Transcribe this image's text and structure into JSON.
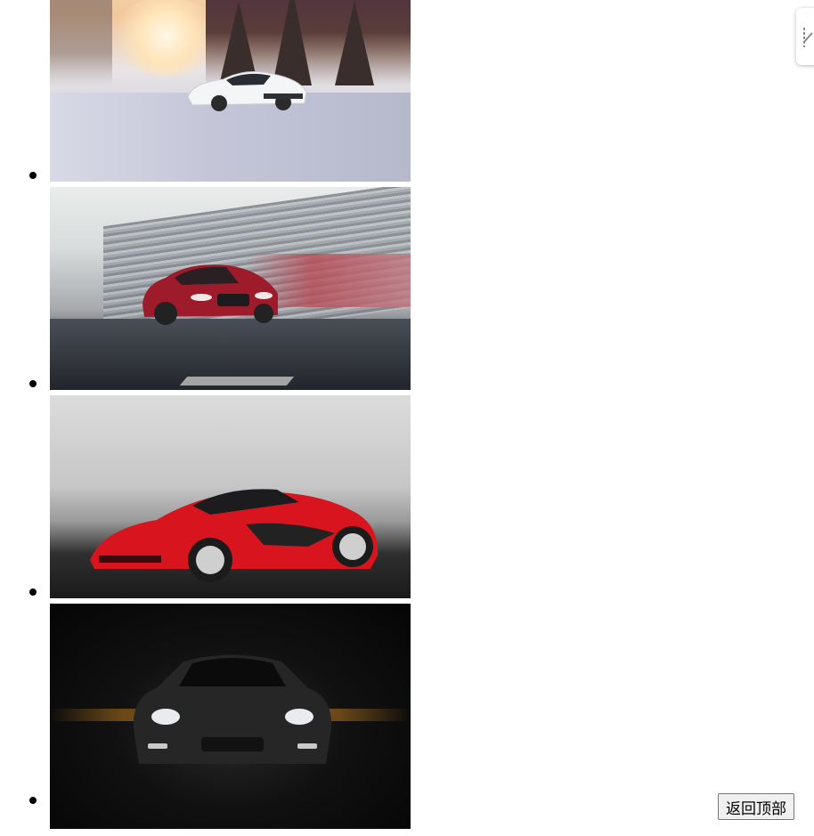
{
  "gallery": {
    "items": [
      {
        "icon": "white-supercar-snow-photo"
      },
      {
        "icon": "red-sedan-motion-photo"
      },
      {
        "icon": "red-supercar-photo"
      },
      {
        "icon": "black-car-dark-photo"
      }
    ]
  },
  "side_tab": {
    "icon": "floating-tab-icon"
  },
  "back_to_top": {
    "label": "返回顶部"
  }
}
